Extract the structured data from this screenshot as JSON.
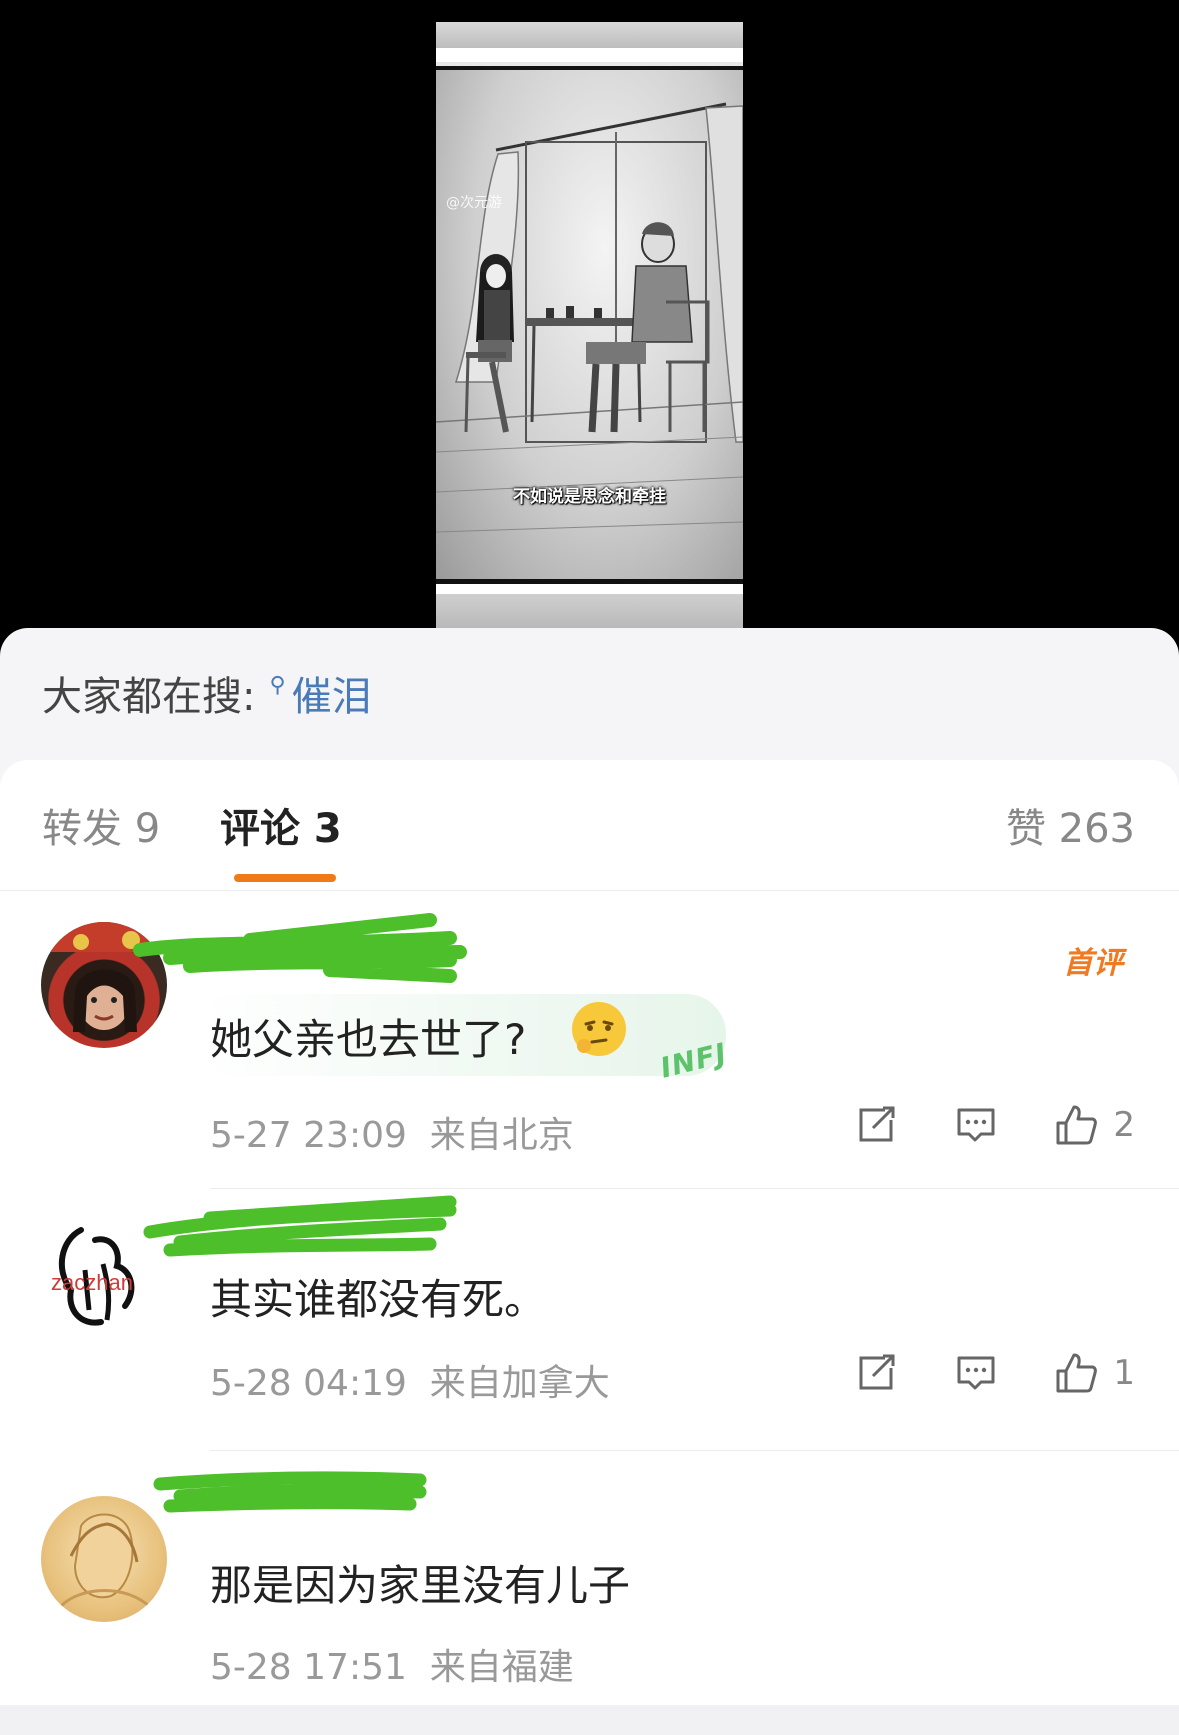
{
  "video": {
    "subtitle": "不如说是思念和牵挂",
    "watermark": "@次元游"
  },
  "search": {
    "prefix": "大家都在搜:",
    "keyword": "催泪"
  },
  "tabs": {
    "repost_label": "转发 9",
    "comment_label": "评论 3",
    "like_label": "赞 263"
  },
  "comments": [
    {
      "text": "她父亲也去世了?",
      "time": "5-27 23:09",
      "location": "来自北京",
      "likes": "2",
      "badge": "首评",
      "decoration": "INFJ"
    },
    {
      "avatar_text": "zaczhan",
      "text": "其实谁都没有死。",
      "time": "5-28 04:19",
      "location": "来自加拿大",
      "likes": "1"
    },
    {
      "text": "那是因为家里没有儿子",
      "time": "5-28 17:51",
      "location": "来自福建"
    }
  ],
  "colors": {
    "accent": "#ef7a1a",
    "keyword": "#4a7bb7",
    "redact": "#4cbf2a"
  },
  "icons": [
    "search-icon",
    "repost-icon",
    "reply-icon",
    "like-icon"
  ]
}
